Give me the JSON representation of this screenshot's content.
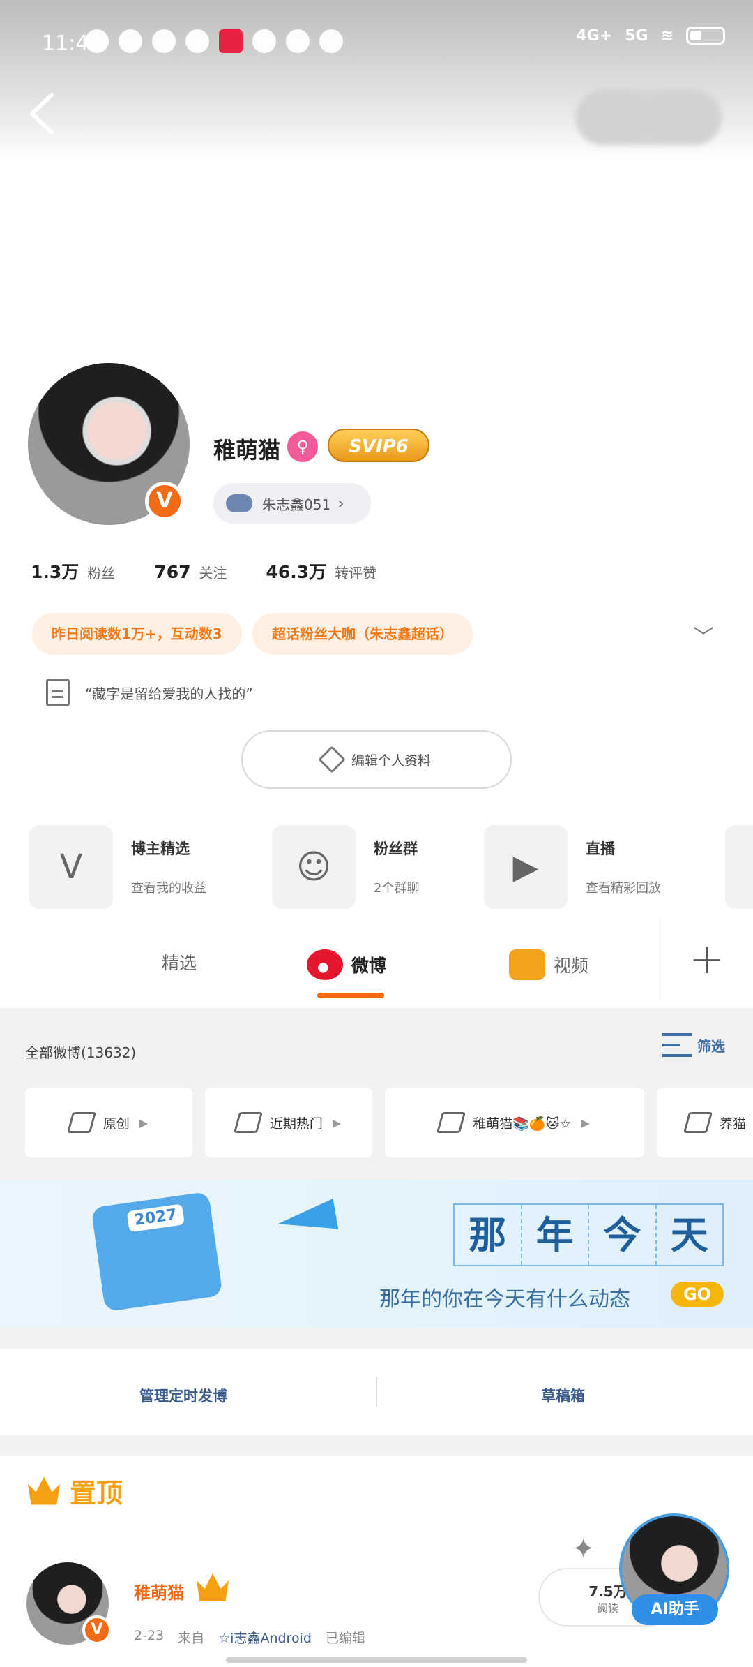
{
  "status_bar": {
    "time": "11:42",
    "network": [
      "4G+",
      "5G"
    ]
  },
  "profile": {
    "name": "稚萌猫",
    "svip": "SVIP6",
    "supertopic": "朱志鑫051",
    "verified_badge": "V",
    "gender_symbol": "♀"
  },
  "stats": [
    {
      "value": "1.3万",
      "label": "粉丝"
    },
    {
      "value": "767",
      "label": "关注"
    },
    {
      "value": "46.3万",
      "label": "转评赞"
    }
  ],
  "tags": [
    "昨日阅读数1万+，互动数3",
    "超话粉丝大咖（朱志鑫超话）"
  ],
  "bio": "“藏字是留给爱我的人找的”",
  "edit_profile": "编辑个人资料",
  "features": [
    {
      "title": "博主精选",
      "sub": "查看我的收益",
      "icon": "v-plus-icon"
    },
    {
      "title": "粉丝群",
      "sub": "2个群聊",
      "icon": "group-icon"
    },
    {
      "title": "直播",
      "sub": "查看精彩回放",
      "icon": "tv-icon"
    }
  ],
  "tabs": [
    {
      "label": "精选"
    },
    {
      "label": "微博"
    },
    {
      "label": "视频"
    }
  ],
  "feed_header": {
    "count_label": "全部微博(13632)",
    "filter": "筛选"
  },
  "chips": [
    "原创",
    "近期热门",
    "稚萌猫📚🍊🐱☆",
    "养猫"
  ],
  "banner": {
    "cal_year": "2027",
    "cells": [
      "那",
      "年",
      "今",
      "天"
    ],
    "subtitle": "那年的你在今天有什么动态",
    "go": "GO"
  },
  "management": {
    "scheduled": "管理定时发博",
    "drafts": "草稿箱"
  },
  "pinned": {
    "label": "置顶"
  },
  "post": {
    "author": "稚萌猫",
    "date": "2-23",
    "from": "来自",
    "source": "☆i志鑫Android",
    "edited": "已编辑",
    "reads_value": "7.5万",
    "reads_label": "阅读",
    "ai_label": "AI助手"
  },
  "icons": {
    "back": "back-arrow-icon",
    "plus": "plus-icon",
    "expand": "chevron-down-icon"
  },
  "colors": {
    "accent": "#f26a16",
    "link": "#3b5b8a",
    "gold": "#f5a011"
  }
}
